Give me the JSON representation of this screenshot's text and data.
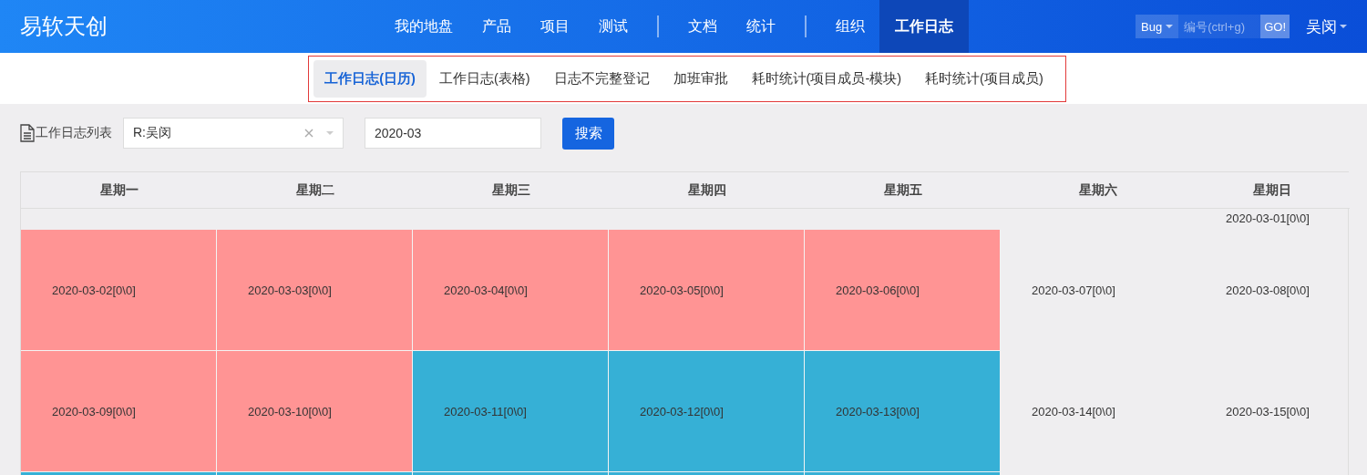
{
  "header": {
    "logo": "易软天创",
    "nav": [
      {
        "kind": "link",
        "label": "我的地盘",
        "selected": false
      },
      {
        "kind": "link",
        "label": "产品",
        "selected": false
      },
      {
        "kind": "link",
        "label": "项目",
        "selected": false
      },
      {
        "kind": "link",
        "label": "测试",
        "selected": false
      },
      {
        "kind": "divider"
      },
      {
        "kind": "link",
        "label": "文档",
        "selected": false
      },
      {
        "kind": "link",
        "label": "统计",
        "selected": false
      },
      {
        "kind": "divider"
      },
      {
        "kind": "link",
        "label": "组织",
        "selected": false
      },
      {
        "kind": "link",
        "label": "工作日志",
        "selected": true
      }
    ],
    "search_type": "Bug",
    "search": {
      "placeholder": "编号(ctrl+g)"
    },
    "go_button": "GO!",
    "user": "吴闵"
  },
  "subnav": [
    {
      "label": "工作日志(日历)",
      "selected": true
    },
    {
      "label": "工作日志(表格)",
      "selected": false
    },
    {
      "label": "日志不完整登记",
      "selected": false
    },
    {
      "label": "加班审批",
      "selected": false
    },
    {
      "label": "耗时统计(项目成员-模块)",
      "selected": false
    },
    {
      "label": "耗时统计(项目成员)",
      "selected": false
    }
  ],
  "toolbar": {
    "title": "工作日志列表",
    "user_select": "R:吴闵",
    "month": "2020-03",
    "search_button": "搜索"
  },
  "calendar": {
    "weekdays": [
      "星期一",
      "星期二",
      "星期三",
      "星期四",
      "星期五",
      "星期六",
      "星期日"
    ],
    "weeks": [
      {
        "kind": "partial",
        "days": [
          {
            "kind": "empty"
          },
          {
            "kind": "empty"
          },
          {
            "kind": "empty"
          },
          {
            "kind": "empty"
          },
          {
            "kind": "empty"
          },
          {
            "kind": "empty"
          },
          {
            "kind": "day",
            "date": "2020-03-01[0\\0]"
          }
        ]
      },
      {
        "kind": "full",
        "days": [
          {
            "date": "2020-03-02[0\\0]",
            "color": "#ff9494"
          },
          {
            "date": "2020-03-03[0\\0]",
            "color": "#ff9494"
          },
          {
            "date": "2020-03-04[0\\0]",
            "color": "#ff9494"
          },
          {
            "date": "2020-03-05[0\\0]",
            "color": "#ff9494"
          },
          {
            "date": "2020-03-06[0\\0]",
            "color": "#ff9494"
          },
          {
            "date": "2020-03-07[0\\0]"
          },
          {
            "date": "2020-03-08[0\\0]"
          }
        ]
      },
      {
        "kind": "full",
        "days": [
          {
            "date": "2020-03-09[0\\0]",
            "color": "#ff9494"
          },
          {
            "date": "2020-03-10[0\\0]",
            "color": "#ff9494"
          },
          {
            "date": "2020-03-11[0\\0]",
            "color": "#36b0d6"
          },
          {
            "date": "2020-03-12[0\\0]",
            "color": "#36b0d6"
          },
          {
            "date": "2020-03-13[0\\0]",
            "color": "#36b0d6"
          },
          {
            "date": "2020-03-14[0\\0]"
          },
          {
            "date": "2020-03-15[0\\0]"
          }
        ]
      },
      {
        "kind": "full",
        "days": [
          {
            "kind": "day",
            "color": "#36b0d6"
          },
          {
            "kind": "day",
            "color": "#36b0d6"
          },
          {
            "kind": "day",
            "color": "#36b0d6"
          },
          {
            "kind": "day",
            "color": "#36b0d6"
          },
          {
            "kind": "day",
            "color": "#36b0d6"
          },
          {
            "kind": "empty"
          },
          {
            "kind": "empty"
          }
        ]
      }
    ]
  }
}
